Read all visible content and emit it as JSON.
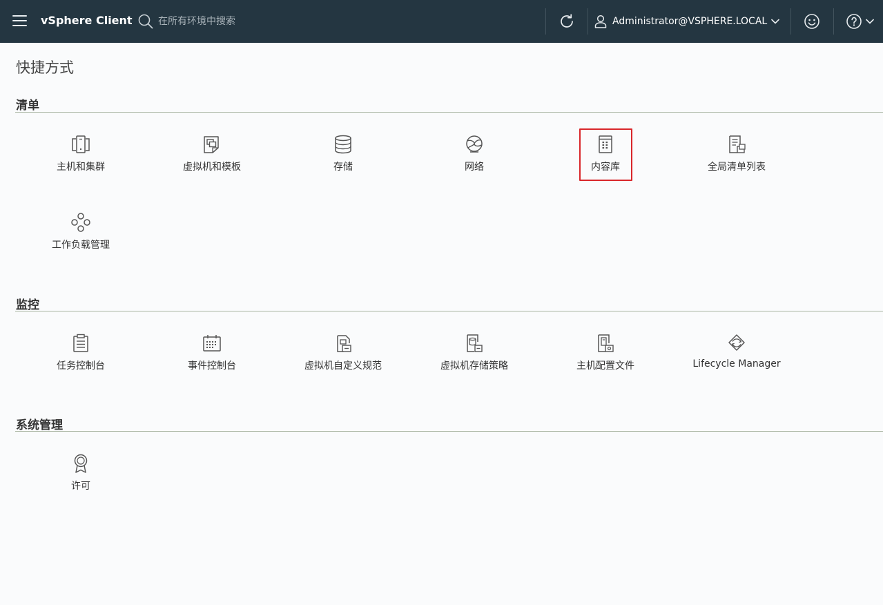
{
  "header": {
    "app_title": "vSphere Client",
    "search_placeholder": "在所有环境中搜索",
    "user": "Administrator@VSPHERE.LOCAL",
    "icons": [
      "menu-icon",
      "search-icon",
      "refresh-icon",
      "user-icon",
      "chevron-down-icon",
      "smiley-icon",
      "help-icon"
    ]
  },
  "page": {
    "title": "快捷方式"
  },
  "sections": {
    "inventory": {
      "title": "清单",
      "items": [
        {
          "label": "主机和集群",
          "icon": "hosts-clusters-icon"
        },
        {
          "label": "虚拟机和模板",
          "icon": "vms-templates-icon"
        },
        {
          "label": "存储",
          "icon": "storage-icon"
        },
        {
          "label": "网络",
          "icon": "network-icon"
        },
        {
          "label": "内容库",
          "icon": "content-library-icon",
          "selected": true
        },
        {
          "label": "全局清单列表",
          "icon": "global-inventory-icon"
        },
        {
          "label": "工作负载管理",
          "icon": "workload-management-icon"
        }
      ]
    },
    "monitoring": {
      "title": "监控",
      "items": [
        {
          "label": "任务控制台",
          "icon": "task-console-icon"
        },
        {
          "label": "事件控制台",
          "icon": "event-console-icon"
        },
        {
          "label": "虚拟机自定义规范",
          "icon": "vm-customization-icon"
        },
        {
          "label": "虚拟机存储策略",
          "icon": "vm-storage-policy-icon"
        },
        {
          "label": "主机配置文件",
          "icon": "host-profiles-icon"
        },
        {
          "label": "Lifecycle Manager",
          "icon": "lifecycle-manager-icon"
        }
      ]
    },
    "administration": {
      "title": "系统管理",
      "items": [
        {
          "label": "许可",
          "icon": "licensing-icon"
        }
      ]
    }
  },
  "colors": {
    "header_bg": "#243641",
    "page_bg": "#fafbfc",
    "selection_border": "#d9262a",
    "section_rule": "#a7b3a0"
  }
}
